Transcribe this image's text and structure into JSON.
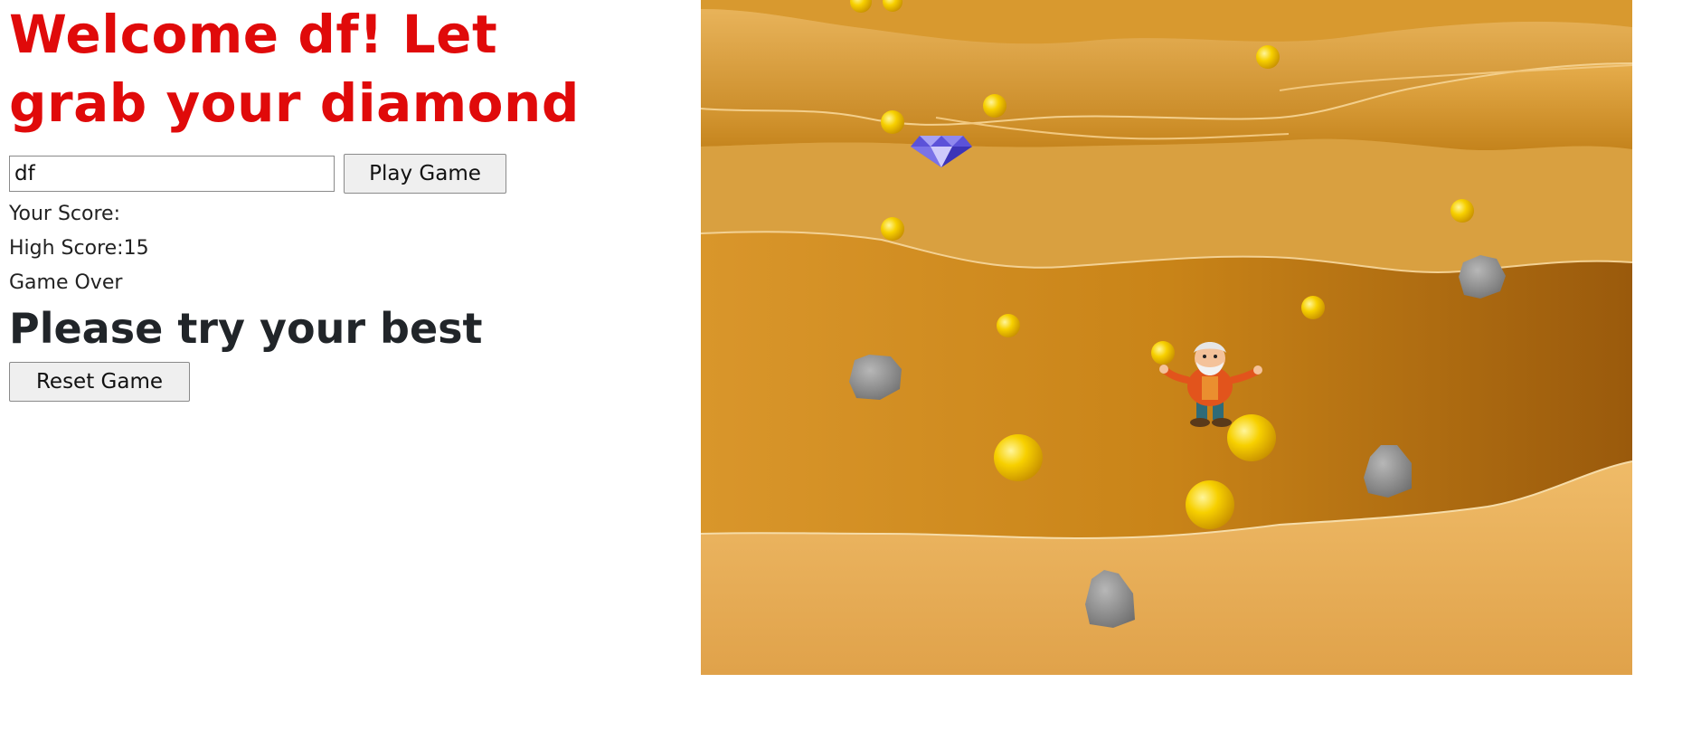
{
  "welcome": {
    "title": "Welcome df! Let grab your diamond"
  },
  "form": {
    "name_value": "df",
    "play_label": "Play Game"
  },
  "status": {
    "score_text": "Your Score:",
    "high_score_text": "High Score:15",
    "game_over_text": "Game Over",
    "encourage_text": "Please try your best"
  },
  "reset_label": "Reset Game",
  "game": {
    "scene": "gold-mine",
    "objects": [
      "gold-nugget",
      "diamond",
      "rock",
      "miner"
    ]
  },
  "colors": {
    "title_red": "#e00a0a",
    "gold": "#f2c200",
    "sand": "#d9952b"
  }
}
